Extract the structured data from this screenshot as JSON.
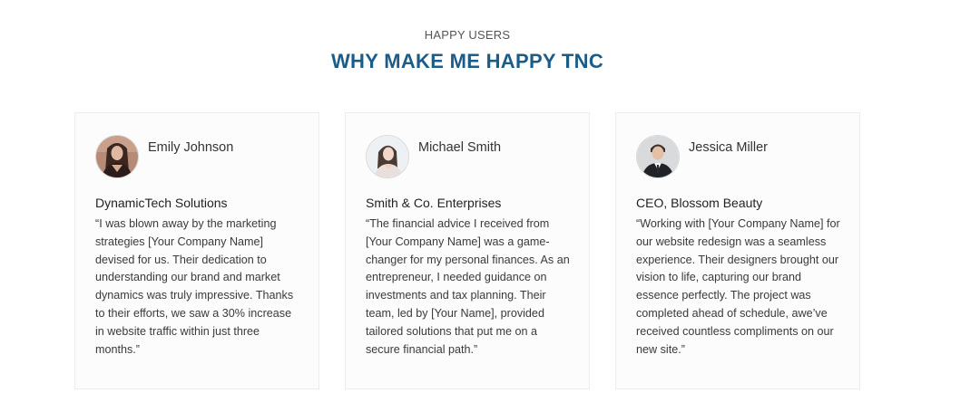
{
  "section": {
    "eyebrow": "HAPPY USERS",
    "title": "WHY MAKE ME HAPPY TNC"
  },
  "colors": {
    "title": "#1d5c87",
    "card_background": "#fcfcfc",
    "card_border": "#ececec"
  },
  "testimonials": [
    {
      "name": "Emily Johnson",
      "company": "DynamicTech Solutions",
      "quote": "“I was blown away by the marketing strategies [Your Company Name] devised for us. Their dedication to understanding our brand and market dynamics was truly impressive. Thanks to their efforts, we saw a 30% increase in website traffic within just three months.”",
      "avatar_icon": "avatar-photo-woman-dark-hair"
    },
    {
      "name": "Michael Smith",
      "company": "Smith & Co. Enterprises",
      "quote": "“The financial advice I received from [Your Company Name] was a game-changer for my personal finances. As an entrepreneur, I needed guidance on investments and tax planning. Their team, led by [Your Name], provided tailored solutions that put me on a secure financial path.”",
      "avatar_icon": "avatar-photo-woman-light-background"
    },
    {
      "name": "Jessica Miller",
      "company": "CEO, Blossom Beauty",
      "quote": "“Working with [Your Company Name] for our website redesign was a seamless experience. Their designers brought our vision to life, capturing our brand essence perfectly. The project was completed ahead of schedule, awe’ve received countless compliments on our new site.”",
      "avatar_icon": "avatar-photo-man-suit"
    }
  ]
}
